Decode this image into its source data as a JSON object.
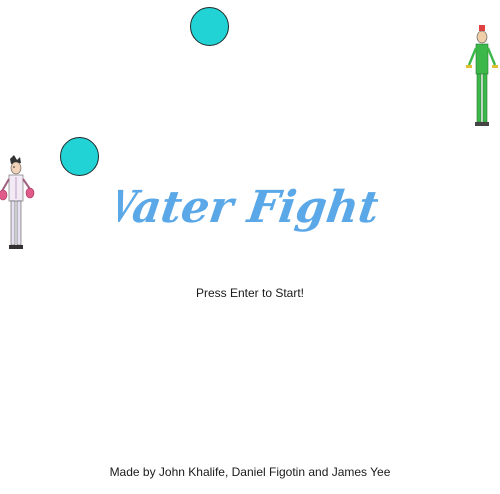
{
  "game": {
    "title": "Water Fight!",
    "prompt": "Press Enter to Start!",
    "credits": "Made by John Khalife, Daniel Figotin and James Yee"
  },
  "colors": {
    "background": "#ffffff",
    "water_ball": "#22d3d6",
    "title": "#5aa8e8",
    "player_left_accent": "#e05a8a",
    "player_right_accent": "#3cb84a"
  },
  "sprites": {
    "water_balls": [
      "water-ball",
      "water-ball"
    ],
    "players": [
      "player-left-sprite",
      "player-right-sprite"
    ]
  }
}
